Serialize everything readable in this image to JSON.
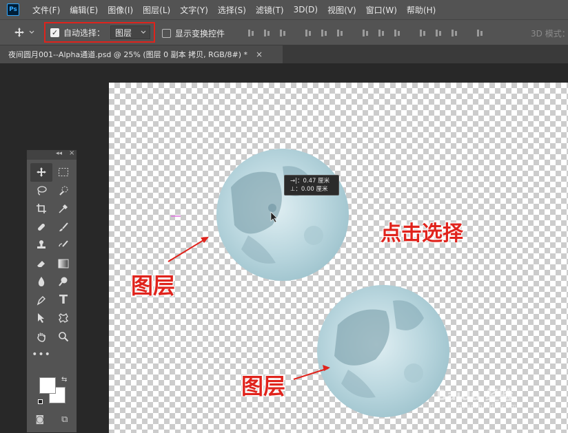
{
  "app": {
    "logo": "Ps"
  },
  "menu": [
    "文件(F)",
    "编辑(E)",
    "图像(I)",
    "图层(L)",
    "文字(Y)",
    "选择(S)",
    "滤镜(T)",
    "3D(D)",
    "视图(V)",
    "窗口(W)",
    "帮助(H)"
  ],
  "options": {
    "move_icon": "move-icon",
    "auto_select_label": "自动选择：",
    "auto_select_checked": true,
    "auto_select_target": "图层",
    "show_transform_label": "显示变换控件",
    "show_transform_checked": false,
    "mode_3d_label": "3D 模式："
  },
  "document_tab": {
    "title": "夜间圆月001--Alpha通道.psd @ 25% (图层 0 副本 拷贝, RGB/8#) *",
    "close": "×"
  },
  "move_info": {
    "dx_label": "→|：",
    "dx_value": "0.47 厘米",
    "dy_label": "⊥：",
    "dy_value": "0.00 厘米"
  },
  "annotations": {
    "click_select": "点击选择",
    "layer_1": "图层",
    "layer_2": "图层"
  },
  "watermark": {
    "text": "Baidu 经验",
    "sub": "jingyan.baidu.com"
  },
  "colors": {
    "accent_red": "#e0231c",
    "panel": "#535353",
    "workspace": "#282828"
  }
}
